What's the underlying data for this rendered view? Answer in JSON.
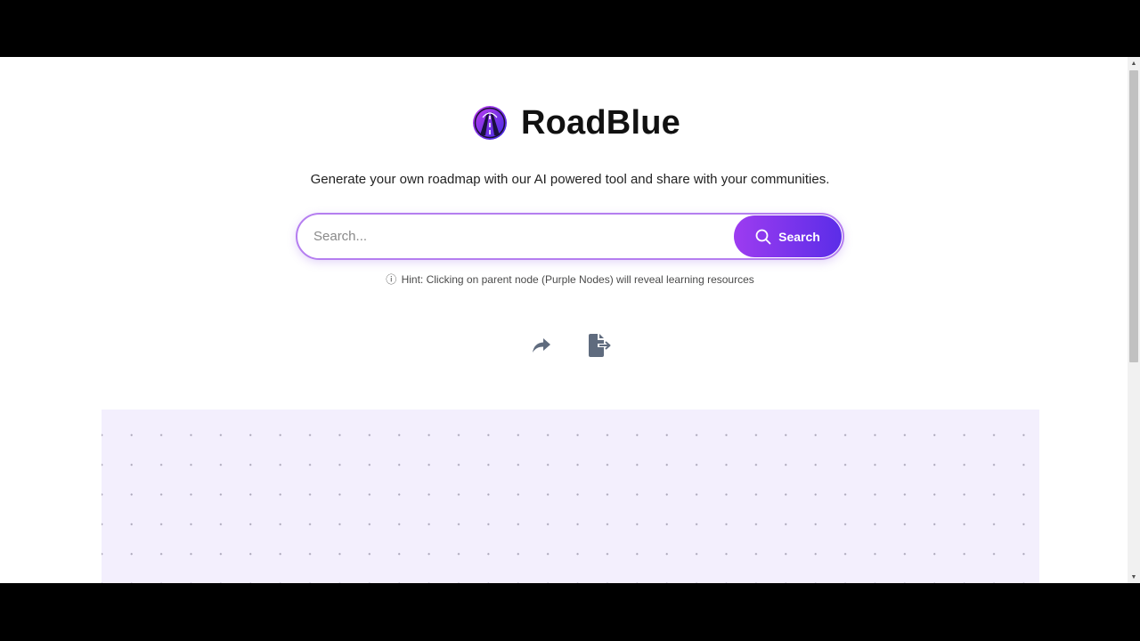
{
  "brand": {
    "name": "RoadBlue",
    "logo_icon": "road-logo-icon"
  },
  "tagline": "Generate your own roadmap with our AI powered tool and share with your communities.",
  "search": {
    "placeholder": "Search...",
    "value": "",
    "button_label": "Search",
    "button_icon": "search-icon"
  },
  "hint": {
    "icon": "ⓘ",
    "text": "Hint: Clicking on parent node (Purple Nodes) will reveal learning resources"
  },
  "actions": [
    {
      "name": "share",
      "icon": "share-icon"
    },
    {
      "name": "export",
      "icon": "file-export-icon"
    }
  ],
  "colors": {
    "accent_start": "#9d3cf0",
    "accent_end": "#5b2de8",
    "canvas_bg": "#f3effd",
    "icon_gray": "#5f6b7e"
  }
}
